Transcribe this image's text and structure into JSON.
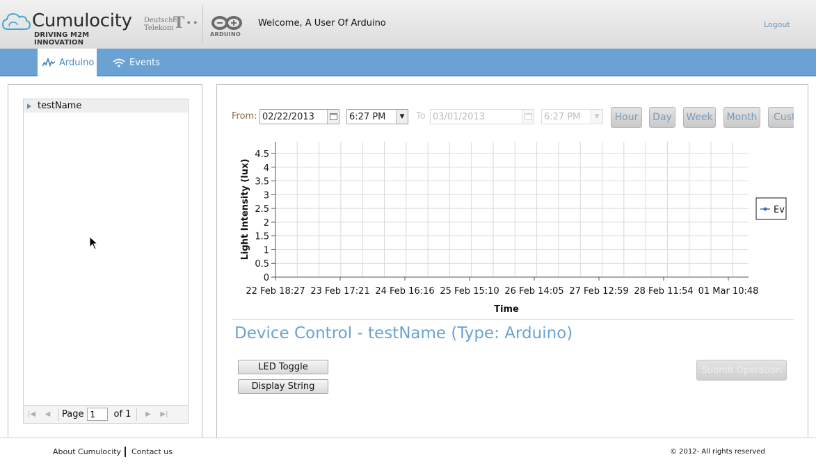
{
  "header": {
    "brand_name": "Cumulocity",
    "brand_tagline": "DRIVING M2M INNOVATION",
    "partner_line1": "Deutsche",
    "partner_line2": "Telekom",
    "partner_mark": "T··",
    "arduino_logo_text": "ARDUINO",
    "welcome": "Welcome, A User Of Arduino",
    "logout": "Logout"
  },
  "nav": {
    "tabs": [
      {
        "label": "Arduino",
        "icon": "activity-icon",
        "active": true
      },
      {
        "label": "Events",
        "icon": "wifi-icon",
        "active": false
      }
    ]
  },
  "tree": {
    "nodes": [
      {
        "label": "testName"
      }
    ],
    "pager": {
      "page_label": "Page",
      "page_value": "1",
      "of_label": "of 1"
    }
  },
  "range": {
    "from_label": "From:",
    "from_date": "02/22/2013",
    "from_time": "6:27 PM",
    "to_label": "To",
    "to_date": "03/01/2013",
    "to_time": "6:27 PM",
    "buttons": [
      "Hour",
      "Day",
      "Week",
      "Month",
      "Custo"
    ]
  },
  "chart_data": {
    "type": "line",
    "title": "",
    "xlabel": "Time",
    "ylabel": "Light Intensity (lux)",
    "ylim": [
      0,
      4.5
    ],
    "yticks": [
      0,
      0.5,
      1,
      1.5,
      2,
      2.5,
      3,
      3.5,
      4,
      4.5
    ],
    "xticks": [
      "22 Feb 18:27",
      "23 Feb 17:21",
      "24 Feb 16:16",
      "25 Feb 15:10",
      "26 Feb 14:05",
      "27 Feb 12:59",
      "28 Feb 11:54",
      "01 Mar 10:48"
    ],
    "grid": true,
    "legend_position": "right",
    "series": [
      {
        "name": "Ev",
        "values": [],
        "color": "#3a6fa8"
      }
    ]
  },
  "device_control": {
    "title": "Device Control - testName (Type: Arduino)",
    "buttons": [
      "LED Toggle",
      "Display String"
    ],
    "submit": "Submit Operation"
  },
  "footer": {
    "about": "About Cumulocity",
    "contact": "Contact us",
    "copyright": "© 2012- All rights reserved"
  },
  "colors": {
    "accent": "#6aa3d3",
    "nav_bar": "#6aa3d3",
    "link": "#6a8fb3"
  }
}
